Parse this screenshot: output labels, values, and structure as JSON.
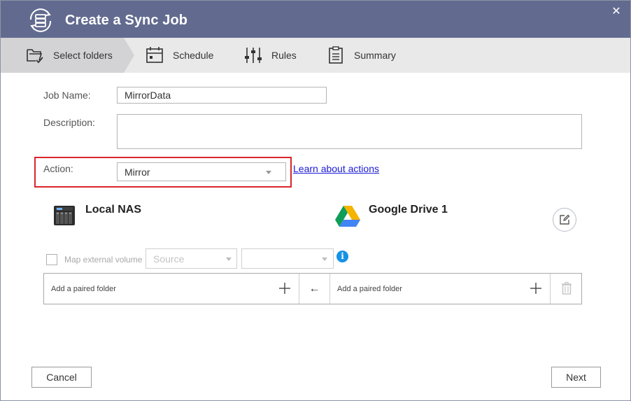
{
  "window": {
    "title": "Create a Sync Job",
    "close_glyph": "✕"
  },
  "steps": [
    {
      "label": "Select folders",
      "icon": "folder-check-icon",
      "active": true
    },
    {
      "label": "Schedule",
      "icon": "calendar-icon",
      "active": false
    },
    {
      "label": "Rules",
      "icon": "sliders-icon",
      "active": false
    },
    {
      "label": "Summary",
      "icon": "clipboard-icon",
      "active": false
    }
  ],
  "form": {
    "job_name_label": "Job Name:",
    "job_name_value": "MirrorData",
    "description_label": "Description:",
    "description_value": "",
    "action_label": "Action:",
    "action_value": "Mirror",
    "learn_link": "Learn about actions"
  },
  "source": {
    "name": "Local NAS",
    "icon": "nas-device-icon"
  },
  "destination": {
    "name": "Google Drive 1",
    "icon": "google-drive-icon"
  },
  "external_volume": {
    "label": "Map external volume",
    "checked": false,
    "source_placeholder": "Source",
    "second_value": ""
  },
  "pairing": {
    "left_label": "Add a paired folder",
    "right_label": "Add a paired folder",
    "direction_glyph": "←"
  },
  "buttons": {
    "cancel": "Cancel",
    "next": "Next"
  },
  "colors": {
    "titlebar": "#626b8f",
    "stepbar": "#e9e9ea",
    "highlight_border": "#d9262c",
    "link": "#1a1ad8",
    "info": "#1592e6"
  }
}
